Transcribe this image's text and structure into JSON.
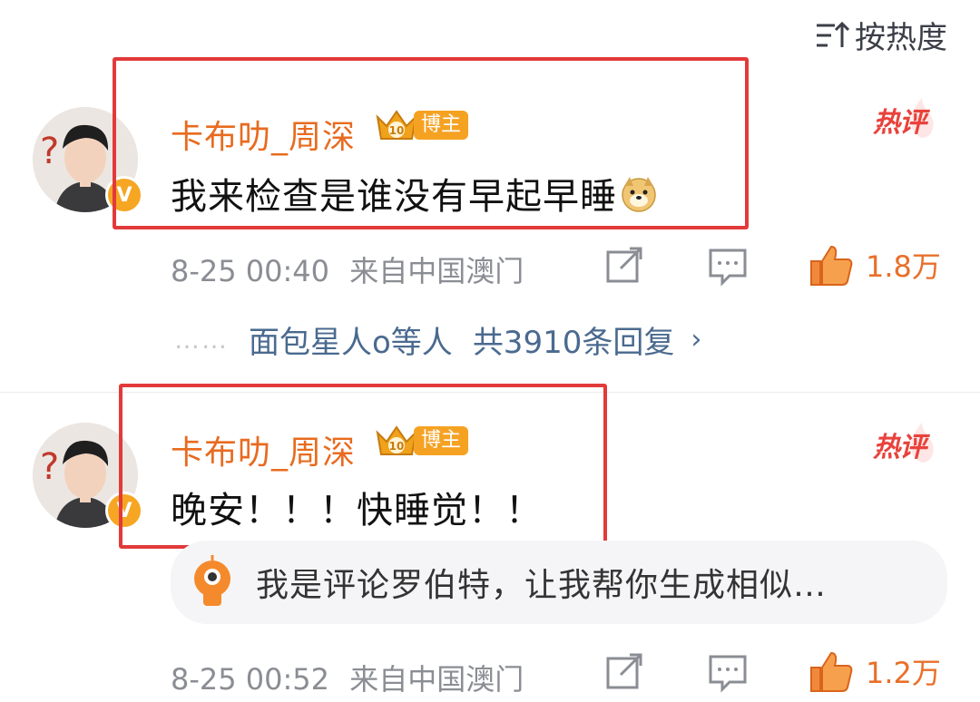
{
  "sort": {
    "label": "按热度",
    "icon": "sort-icon"
  },
  "comments": [
    {
      "username": "卡布叻_周深",
      "badge": "博主",
      "level": "10",
      "text": "我来检查是谁没有早起早睡",
      "emoji": "doge-emoji",
      "hot_label": "热评",
      "time": "8-25 00:40",
      "location": "来自中国澳门",
      "likes": "1.8万",
      "replies_users": "面包星人o等人",
      "replies_count": "共3910条回复",
      "replies_dots": "……"
    },
    {
      "username": "卡布叻_周深",
      "badge": "博主",
      "level": "10",
      "text": "晚安！！！快睡觉！！",
      "hot_label": "热评",
      "ai_prompt": "我是评论罗伯特，让我帮你生成相似…",
      "time": "8-25 00:52",
      "location": "来自中国澳门",
      "likes": "1.2万"
    }
  ],
  "colors": {
    "accent": "#e86b1f",
    "hot": "#e8423c",
    "highlight_box": "#e23a3a",
    "link": "#4a6a8f"
  }
}
